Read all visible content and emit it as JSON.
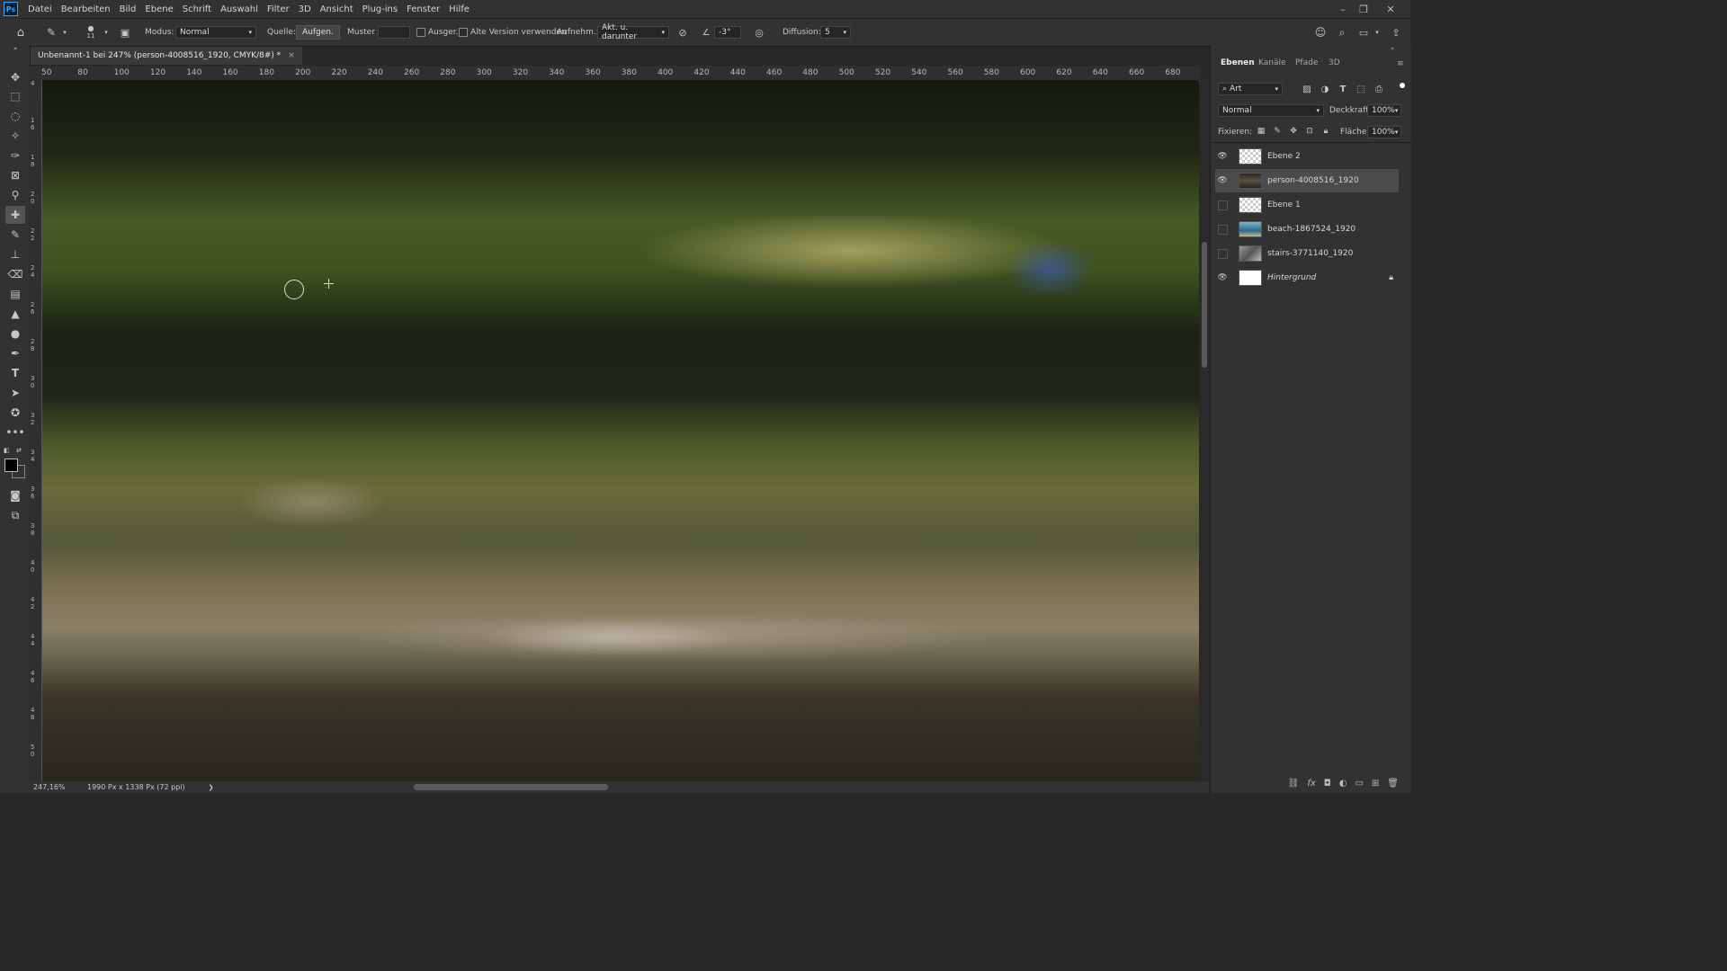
{
  "menu": {
    "logo": "Ps",
    "items": [
      "Datei",
      "Bearbeiten",
      "Bild",
      "Ebene",
      "Schrift",
      "Auswahl",
      "Filter",
      "3D",
      "Ansicht",
      "Plug-ins",
      "Fenster",
      "Hilfe"
    ]
  },
  "window_controls": {
    "minimize": "–",
    "restore": "❐",
    "close": "✕"
  },
  "options": {
    "brush_size": "11",
    "mode_label": "Modus:",
    "mode_value": "Normal",
    "source_label": "Quelle:",
    "source_sampled": "Aufgen.",
    "source_pattern": "Muster",
    "aligned_label": "Ausger.",
    "legacy_label": "Alte Version verwenden",
    "sample_label": "Aufnehm.:",
    "sample_value": "Akt. u. darunter",
    "angle_value": "-3°",
    "diffusion_label": "Diffusion:",
    "diffusion_value": "5"
  },
  "document": {
    "tab_title": "Unbenannt-1 bei 247% (person-4008516_1920, CMYK/8#) *",
    "close": "×"
  },
  "ruler": {
    "h_labels": [
      "50",
      "80",
      "100",
      "120",
      "140",
      "160",
      "180",
      "200",
      "220",
      "240",
      "260",
      "280",
      "300",
      "320",
      "340",
      "360",
      "380",
      "400",
      "420",
      "440",
      "460",
      "480",
      "500",
      "520",
      "540",
      "560",
      "580",
      "600",
      "620",
      "640",
      "660",
      "680"
    ],
    "v_labels": [
      "4",
      "1 6",
      "1 8",
      "2 0",
      "2 2",
      "2 4",
      "2 6",
      "2 8",
      "3 0",
      "3 2",
      "3 4",
      "3 6",
      "3 8",
      "4 0",
      "4 2",
      "4 4",
      "4 6",
      "4 8",
      "5 0"
    ]
  },
  "status": {
    "zoom": "247,16%",
    "dimensions": "1990 Px x 1338 Px (72 ppi)",
    "arrow": "❯"
  },
  "panel": {
    "tabs": [
      "Ebenen",
      "Kanäle",
      "Pfade",
      "3D"
    ],
    "active_tab": "Ebenen",
    "filter_label": "Art",
    "blend_mode": "Normal",
    "opacity_label": "Deckkraft:",
    "opacity_value": "100%",
    "lock_label": "Fixieren:",
    "fill_label": "Fläche:",
    "fill_value": "100%",
    "layers": [
      {
        "name": "Ebene 2",
        "visible": true,
        "thumb": "transparent",
        "selected": false
      },
      {
        "name": "person-4008516_1920",
        "visible": true,
        "thumb": "photo-dark",
        "selected": true
      },
      {
        "name": "Ebene 1",
        "visible": false,
        "thumb": "transparent",
        "selected": false
      },
      {
        "name": "beach-1867524_1920",
        "visible": false,
        "thumb": "photo-blue",
        "selected": false
      },
      {
        "name": "stairs-3771140_1920",
        "visible": false,
        "thumb": "photo-gray",
        "selected": false
      },
      {
        "name": "Hintergrund",
        "visible": true,
        "thumb": "white",
        "selected": false,
        "locked": true
      }
    ]
  },
  "colors": {
    "accent": "#31a8ff",
    "foreground": "#000000",
    "background": "#ffffff"
  }
}
